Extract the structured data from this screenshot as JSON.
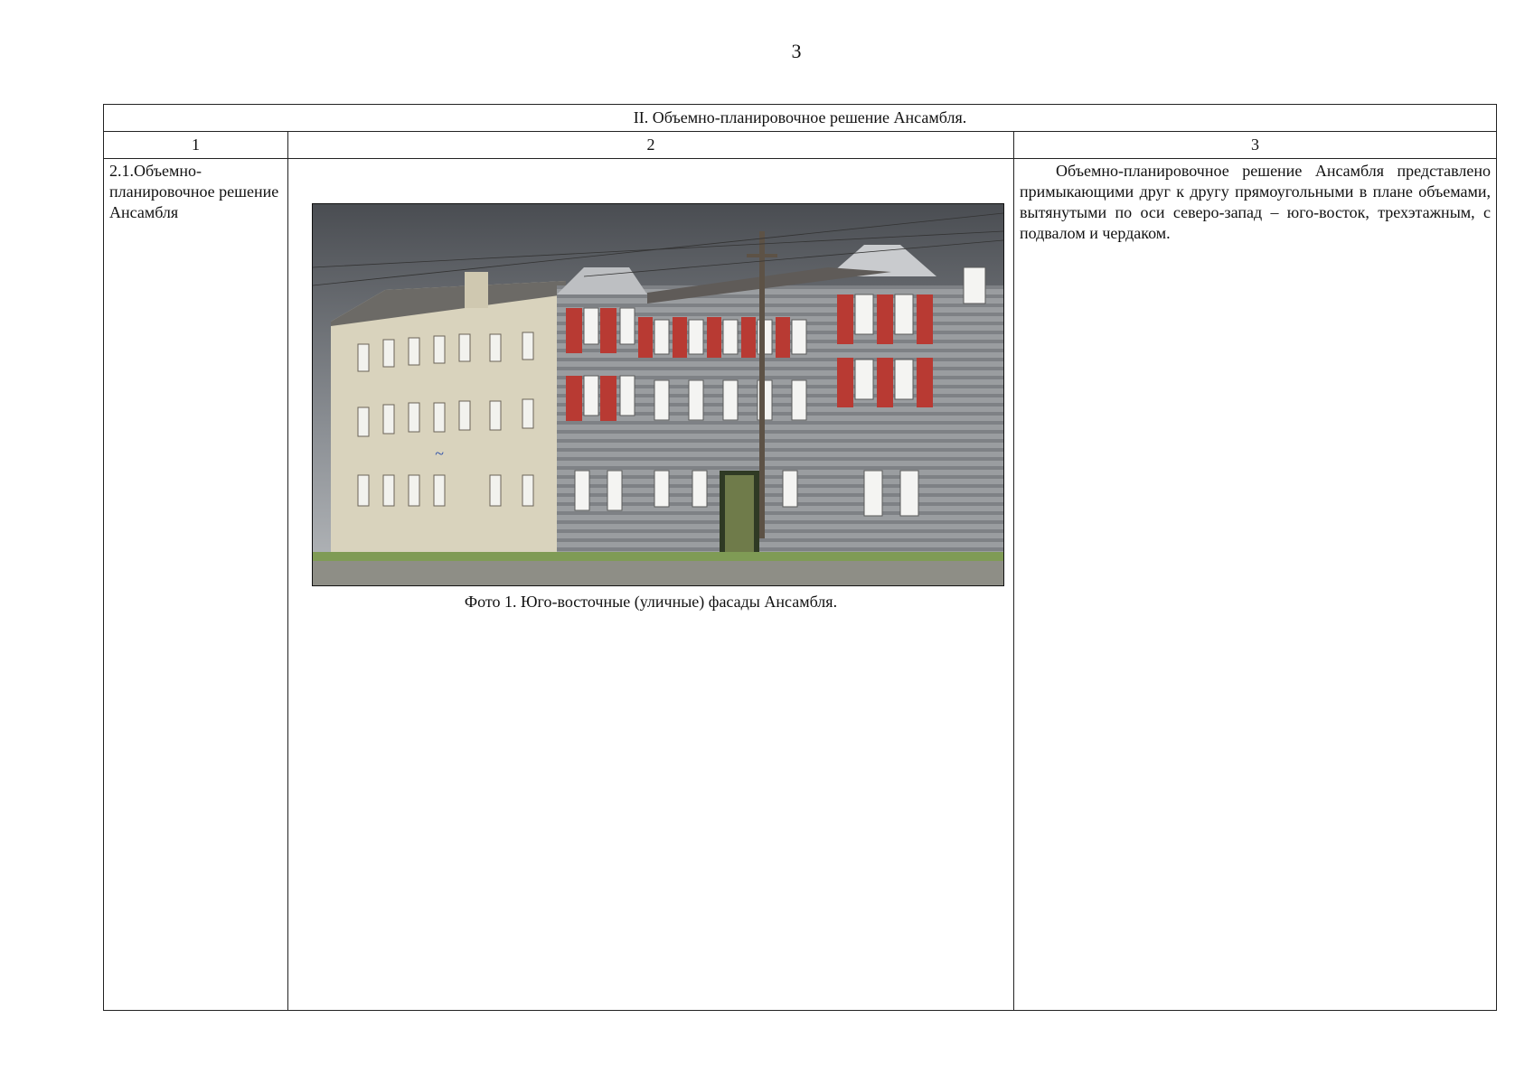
{
  "page": {
    "number": "3"
  },
  "table": {
    "section_title": "II. Объемно-планировочное решение Ансамбля.",
    "column_numbers": [
      "1",
      "2",
      "3"
    ],
    "row": {
      "label": "2.1.Объемно-планировочное решение Ансамбля",
      "photo_caption": "Фото 1. Юго-восточные (уличные) фасады Ансамбля.",
      "description": "Объемно-планировочное решение Ансамбля представлено примыкающими друг к другу прямоугольными в плане объемами, вытянутыми по оси северо-запад – юго-восток, трехэтажным, с подвалом и чердаком."
    }
  }
}
